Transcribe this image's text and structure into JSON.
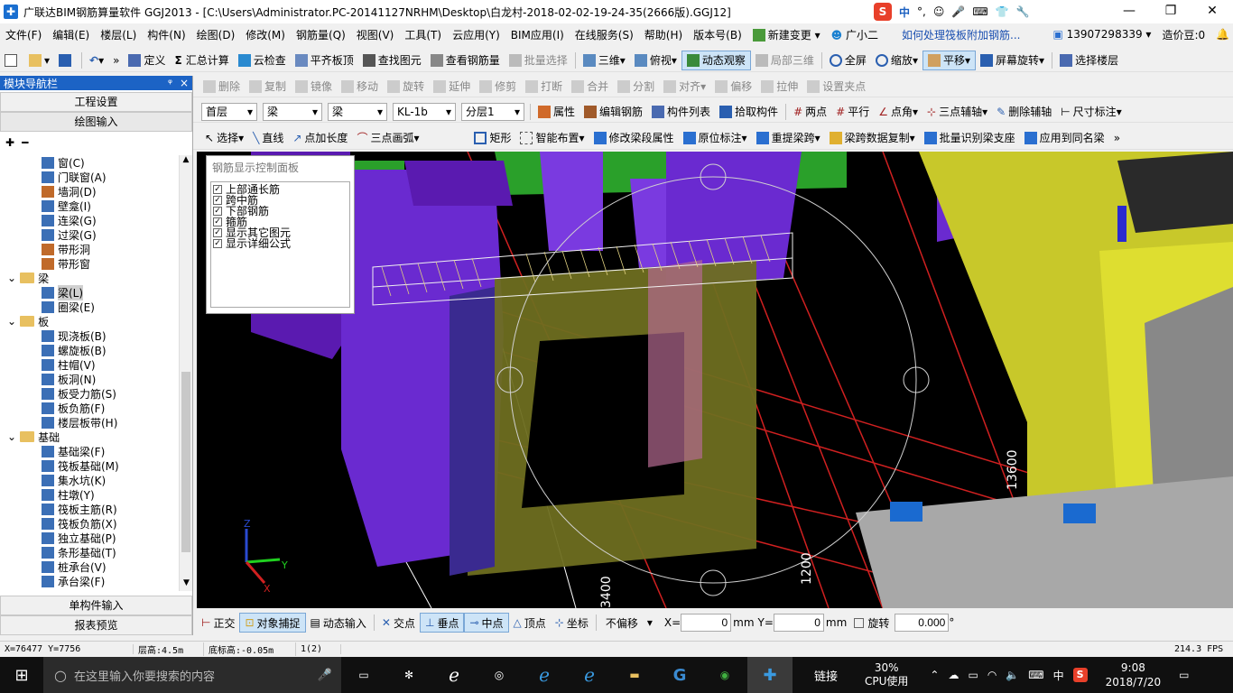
{
  "window": {
    "title": "广联达BIM钢筋算量软件 GGJ2013 - [C:\\Users\\Administrator.PC-20141127NRHM\\Desktop\\白龙村-2018-02-02-19-24-35(2666版).GGJ12]",
    "minimize": "—",
    "restore": "❐",
    "close": "✕"
  },
  "ime_bar": {
    "logo": "S",
    "lang": "中"
  },
  "menu": [
    "文件(F)",
    "编辑(E)",
    "楼层(L)",
    "构件(N)",
    "绘图(D)",
    "修改(M)",
    "钢筋量(Q)",
    "视图(V)",
    "工具(T)",
    "云应用(Y)",
    "BIM应用(I)",
    "在线服务(S)",
    "帮助(H)",
    "版本号(B)"
  ],
  "menu_right": {
    "new_change": "新建变更",
    "assistant": "广小二",
    "question": "如何处理筏板附加钢筋...",
    "phone": "13907298339",
    "beans": "造价豆:0"
  },
  "toolbar1": {
    "define": "定义",
    "summary": "汇总计算",
    "cloud_check": "云检查",
    "align_top": "平齐板顶",
    "find": "查找图元",
    "view_rebar": "查看钢筋量",
    "batch_select": "批量选择",
    "view3d": "三维",
    "top_view": "俯视",
    "dynamic": "动态观察",
    "local3d": "局部三维",
    "fullscreen": "全屏",
    "zoom": "缩放",
    "pan": "平移",
    "rotate_screen": "屏幕旋转",
    "select_floor": "选择楼层"
  },
  "toolbar2": [
    "删除",
    "复制",
    "镜像",
    "移动",
    "旋转",
    "延伸",
    "修剪",
    "打断",
    "合并",
    "分割",
    "对齐",
    "偏移",
    "拉伸",
    "设置夹点"
  ],
  "toolbar3": {
    "floor": "首层",
    "type1": "梁",
    "type2": "梁",
    "element": "KL-1b",
    "layer": "分层1",
    "props": "属性",
    "edit_rebar": "编辑钢筋",
    "elem_list": "构件列表",
    "pick": "拾取构件",
    "two_points": "两点",
    "parallel": "平行",
    "point_angle": "点角",
    "three_aux": "三点辅轴",
    "del_aux": "删除辅轴",
    "dim": "尺寸标注"
  },
  "toolbar4": {
    "select": "选择",
    "line": "直线",
    "point_len": "点加长度",
    "arc": "三点画弧",
    "rect": "矩形",
    "smart": "智能布置",
    "modify_span": "修改梁段属性",
    "orig_mark": "原位标注",
    "relift": "重提梁跨",
    "copy_data": "梁跨数据复制",
    "batch_identify": "批量识别梁支座",
    "apply_same": "应用到同名梁"
  },
  "left_panel": {
    "header": "模块导航栏",
    "pin": "ᵠ",
    "close": "×",
    "project_settings": "工程设置",
    "draw_input": "绘图输入",
    "tree": [
      {
        "label": "窗(C)",
        "level": 2
      },
      {
        "label": "门联窗(A)",
        "level": 2
      },
      {
        "label": "墙洞(D)",
        "level": 2
      },
      {
        "label": "壁龛(I)",
        "level": 2
      },
      {
        "label": "连梁(G)",
        "level": 2
      },
      {
        "label": "过梁(G)",
        "level": 2
      },
      {
        "label": "带形洞",
        "level": 2
      },
      {
        "label": "带形窗",
        "level": 2
      },
      {
        "label": "梁",
        "level": 1,
        "folder": true
      },
      {
        "label": "梁(L)",
        "level": 2,
        "selected": true
      },
      {
        "label": "圈梁(E)",
        "level": 2
      },
      {
        "label": "板",
        "level": 1,
        "folder": true
      },
      {
        "label": "现浇板(B)",
        "level": 2
      },
      {
        "label": "螺旋板(B)",
        "level": 2
      },
      {
        "label": "柱帽(V)",
        "level": 2
      },
      {
        "label": "板洞(N)",
        "level": 2
      },
      {
        "label": "板受力筋(S)",
        "level": 2
      },
      {
        "label": "板负筋(F)",
        "level": 2
      },
      {
        "label": "楼层板带(H)",
        "level": 2
      },
      {
        "label": "基础",
        "level": 1,
        "folder": true
      },
      {
        "label": "基础梁(F)",
        "level": 2
      },
      {
        "label": "筏板基础(M)",
        "level": 2
      },
      {
        "label": "集水坑(K)",
        "level": 2
      },
      {
        "label": "柱墩(Y)",
        "level": 2
      },
      {
        "label": "筏板主筋(R)",
        "level": 2
      },
      {
        "label": "筏板负筋(X)",
        "level": 2
      },
      {
        "label": "独立基础(P)",
        "level": 2
      },
      {
        "label": "条形基础(T)",
        "level": 2
      },
      {
        "label": "桩承台(V)",
        "level": 2
      },
      {
        "label": "承台梁(F)",
        "level": 2
      }
    ],
    "single_input": "单构件输入",
    "report": "报表预览"
  },
  "rebar_panel": {
    "title": "钢筋显示控制面板",
    "items": [
      "上部通长筋",
      "跨中筋",
      "下部钢筋",
      "箍筋",
      "显示其它图元",
      "显示详细公式"
    ]
  },
  "viewport_labels": {
    "dim1": "13600",
    "dim2": "1200",
    "dim3": "3400",
    "axis_z": "Z",
    "axis_y": "Y",
    "axis_x": "X"
  },
  "snap_bar": {
    "ortho": "正交",
    "snap": "对象捕捉",
    "dyn_input": "动态输入",
    "intersect": "交点",
    "perp": "垂点",
    "mid": "中点",
    "vertex": "顶点",
    "coord": "坐标",
    "offset_mode": "不偏移",
    "x_label": "X=",
    "x_value": "0",
    "mm1": "mm",
    "y_label": "Y=",
    "y_value": "0",
    "mm2": "mm",
    "rotate": "旋转",
    "rotate_value": "0.000",
    "deg": "°"
  },
  "status_bar": {
    "coords": "X=76477 Y=7756",
    "floor_h": "层高:4.5m",
    "bottom_h": "底标高:-0.05m",
    "count": "1(2)",
    "fps": "214.3 FPS"
  },
  "taskbar": {
    "search_placeholder": "在这里输入你要搜索的内容",
    "link": "链接",
    "cpu_pct": "30%",
    "cpu_label": "CPU使用",
    "ime": "中",
    "time": "9:08",
    "date": "2018/7/20"
  }
}
